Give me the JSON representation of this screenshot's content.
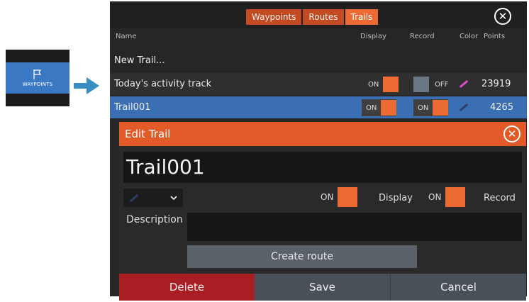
{
  "waypoints_tile": {
    "label": "WAYPOINTS",
    "icon": "flag-icon",
    "color": "#3b78c4"
  },
  "tabs": [
    {
      "label": "Waypoints",
      "active": false
    },
    {
      "label": "Routes",
      "active": false
    },
    {
      "label": "Trails",
      "active": true
    }
  ],
  "columns": {
    "name": "Name",
    "display": "Display",
    "record": "Record",
    "color": "Color",
    "points": "Points"
  },
  "rows": [
    {
      "name": "New Trail..."
    },
    {
      "name": "Today's activity track",
      "display": "ON",
      "record": "OFF",
      "color": "#d64ec8",
      "points": "23919"
    },
    {
      "name": "Trail001",
      "display": "ON",
      "record": "ON",
      "color": "#2d3e6a",
      "points": "4265",
      "selected": true
    }
  ],
  "dialog": {
    "title": "Edit Trail",
    "name_value": "Trail001",
    "display_toggle": "ON",
    "display_label": "Display",
    "record_toggle": "ON",
    "record_label": "Record",
    "description_label": "Description",
    "description_value": "",
    "create_route_label": "Create route",
    "delete_label": "Delete",
    "save_label": "Save",
    "cancel_label": "Cancel"
  },
  "colors": {
    "accent": "#ed6a32",
    "selected_row": "#3b6fb3",
    "delete": "#a81e22",
    "title_bar": "#e15a27"
  }
}
